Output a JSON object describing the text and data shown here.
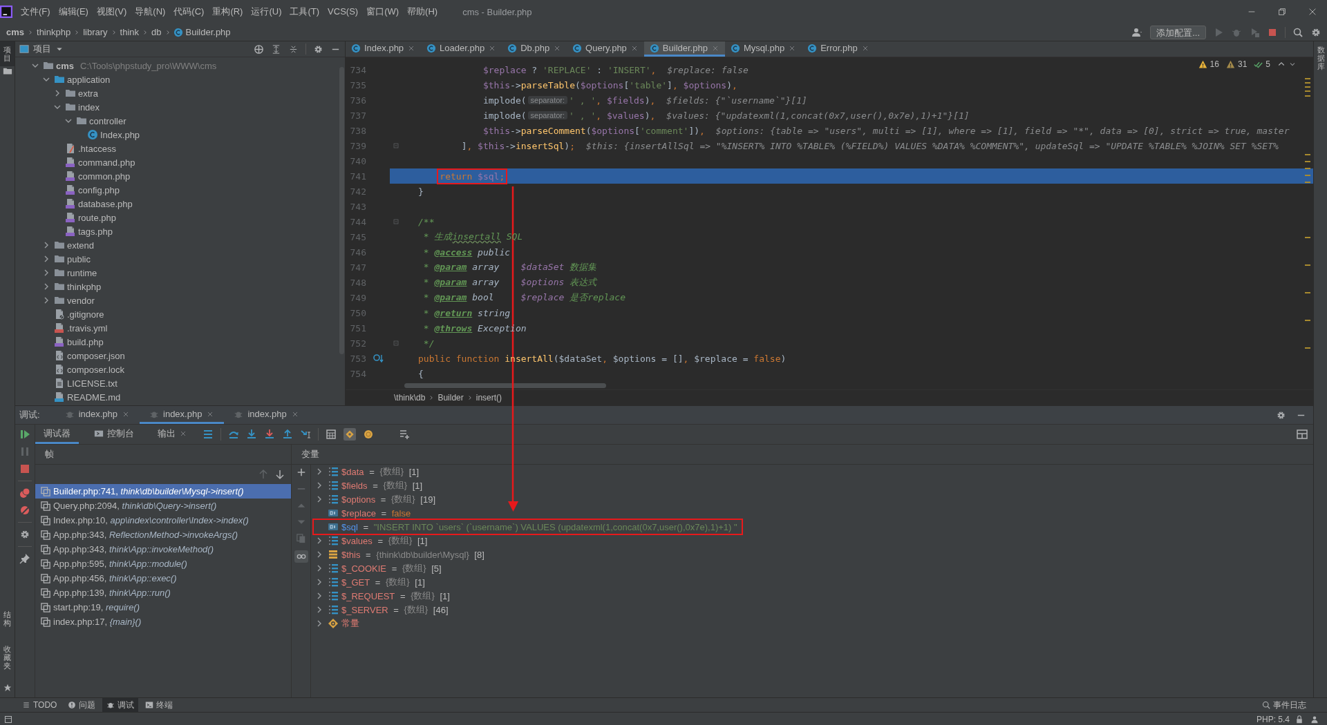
{
  "window": {
    "title": "cms - Builder.php",
    "menu": [
      "文件(F)",
      "编辑(E)",
      "视图(V)",
      "导航(N)",
      "代码(C)",
      "重构(R)",
      "运行(U)",
      "工具(T)",
      "VCS(S)",
      "窗口(W)",
      "帮助(H)"
    ]
  },
  "nav_bar": {
    "breadcrumb": [
      {
        "label": "cms",
        "kind": "root"
      },
      {
        "label": "thinkphp",
        "kind": "folder"
      },
      {
        "label": "library",
        "kind": "folder"
      },
      {
        "label": "think",
        "kind": "folder"
      },
      {
        "label": "db",
        "kind": "folder"
      },
      {
        "label": "Builder.php",
        "kind": "class"
      }
    ],
    "config_button": "添加配置..."
  },
  "left_stripe": {
    "top": [
      {
        "label": "项目",
        "selected": true
      }
    ],
    "bottom": [
      "结构",
      "收藏夹"
    ]
  },
  "right_stripe": [
    "数据库"
  ],
  "project": {
    "title": "项目",
    "tree": [
      {
        "label": "cms",
        "path": "C:\\Tools\\phpstudy_pro\\WWW\\cms",
        "kind": "folder",
        "expanded": true,
        "children": [
          {
            "label": "application",
            "kind": "source_folder",
            "expanded": true,
            "children": [
              {
                "label": "extra",
                "kind": "folder",
                "expanded": false
              },
              {
                "label": "index",
                "kind": "folder",
                "expanded": true,
                "children": [
                  {
                    "label": "controller",
                    "kind": "folder",
                    "expanded": true,
                    "children": [
                      {
                        "label": "Index.php",
                        "kind": "class"
                      }
                    ]
                  }
                ]
              },
              {
                "label": ".htaccess",
                "kind": "htaccess"
              },
              {
                "label": "command.php",
                "kind": "php"
              },
              {
                "label": "common.php",
                "kind": "php"
              },
              {
                "label": "config.php",
                "kind": "php"
              },
              {
                "label": "database.php",
                "kind": "php"
              },
              {
                "label": "route.php",
                "kind": "php"
              },
              {
                "label": "tags.php",
                "kind": "php"
              }
            ]
          },
          {
            "label": "extend",
            "kind": "folder",
            "expanded": false
          },
          {
            "label": "public",
            "kind": "folder",
            "expanded": false
          },
          {
            "label": "runtime",
            "kind": "folder",
            "expanded": false
          },
          {
            "label": "thinkphp",
            "kind": "folder",
            "expanded": false
          },
          {
            "label": "vendor",
            "kind": "folder",
            "expanded": false
          },
          {
            "label": ".gitignore",
            "kind": "ignore"
          },
          {
            "label": ".travis.yml",
            "kind": "yml"
          },
          {
            "label": "build.php",
            "kind": "php"
          },
          {
            "label": "composer.json",
            "kind": "json"
          },
          {
            "label": "composer.lock",
            "kind": "json"
          },
          {
            "label": "LICENSE.txt",
            "kind": "txt"
          },
          {
            "label": "README.md",
            "kind": "md"
          }
        ]
      }
    ]
  },
  "editor": {
    "tabs": [
      {
        "label": "Index.php",
        "selected": false
      },
      {
        "label": "Loader.php",
        "selected": false
      },
      {
        "label": "Db.php",
        "selected": false
      },
      {
        "label": "Query.php",
        "selected": false
      },
      {
        "label": "Builder.php",
        "selected": true
      },
      {
        "label": "Mysql.php",
        "selected": false
      },
      {
        "label": "Error.php",
        "selected": false
      }
    ],
    "inspections": [
      {
        "kind": "warning",
        "count": "16"
      },
      {
        "kind": "weak_warning",
        "count": "31"
      },
      {
        "kind": "ok",
        "count": "5"
      }
    ],
    "lines": [
      {
        "number": "734",
        "current": false,
        "segments": [
          {
            "kind": "code",
            "tokens": [
              {
                "text": "            $replace",
                "kind": "var"
              },
              {
                "text": " ? ",
                "kind": "plain"
              },
              {
                "text": "'REPLACE'",
                "kind": "str"
              },
              {
                "text": " : ",
                "kind": "plain"
              },
              {
                "text": "'INSERT'",
                "kind": "str"
              },
              {
                "text": ",",
                "kind": "kw"
              }
            ]
          },
          {
            "kind": "value",
            "text": "$replace: false"
          }
        ]
      },
      {
        "number": "735",
        "current": false,
        "segments": [
          {
            "kind": "code",
            "tokens": [
              {
                "text": "            $this",
                "kind": "var"
              },
              {
                "text": "->",
                "kind": "plain"
              },
              {
                "text": "parseTable",
                "kind": "fn"
              },
              {
                "text": "(",
                "kind": "plain"
              },
              {
                "text": "$options",
                "kind": "var"
              },
              {
                "text": "[",
                "kind": "plain"
              },
              {
                "text": "'table'",
                "kind": "str"
              },
              {
                "text": "]",
                "kind": "plain"
              },
              {
                "text": ", ",
                "kind": "kw"
              },
              {
                "text": "$options",
                "kind": "var"
              },
              {
                "text": ")",
                "kind": "plain"
              },
              {
                "text": ",",
                "kind": "kw"
              }
            ]
          }
        ]
      },
      {
        "number": "736",
        "current": false,
        "segments": [
          {
            "kind": "code",
            "tokens": [
              {
                "text": "            implode(",
                "kind": "plain"
              }
            ]
          },
          {
            "kind": "hint",
            "text": "separator:"
          },
          {
            "kind": "code",
            "tokens": [
              {
                "text": "' , '",
                "kind": "str"
              },
              {
                "text": ", ",
                "kind": "kw"
              },
              {
                "text": "$fields",
                "kind": "var"
              },
              {
                "text": ")",
                "kind": "plain"
              },
              {
                "text": ",",
                "kind": "kw"
              }
            ]
          },
          {
            "kind": "value",
            "text": "$fields: {\"`username`\"}[1]"
          }
        ]
      },
      {
        "number": "737",
        "current": false,
        "segments": [
          {
            "kind": "code",
            "tokens": [
              {
                "text": "            implode(",
                "kind": "plain"
              }
            ]
          },
          {
            "kind": "hint",
            "text": "separator:"
          },
          {
            "kind": "code",
            "tokens": [
              {
                "text": "' , '",
                "kind": "str"
              },
              {
                "text": ", ",
                "kind": "kw"
              },
              {
                "text": "$values",
                "kind": "var"
              },
              {
                "text": ")",
                "kind": "plain"
              },
              {
                "text": ",",
                "kind": "kw"
              }
            ]
          },
          {
            "kind": "value",
            "text": "$values: {\"updatexml(1,concat(0x7,user(),0x7e),1)+1\"}[1]"
          }
        ]
      },
      {
        "number": "738",
        "current": false,
        "segments": [
          {
            "kind": "code",
            "tokens": [
              {
                "text": "            $this",
                "kind": "var"
              },
              {
                "text": "->",
                "kind": "plain"
              },
              {
                "text": "parseComment",
                "kind": "fn"
              },
              {
                "text": "(",
                "kind": "plain"
              },
              {
                "text": "$options",
                "kind": "var"
              },
              {
                "text": "[",
                "kind": "plain"
              },
              {
                "text": "'comment'",
                "kind": "str"
              },
              {
                "text": "])",
                "kind": "plain"
              },
              {
                "text": ",",
                "kind": "kw"
              }
            ]
          },
          {
            "kind": "value",
            "text": "$options: {table => \"users\", multi => [1], where => [1], field => \"*\", data => [0], strict => true, master"
          }
        ]
      },
      {
        "number": "739",
        "current": false,
        "gutter": {
          "kind": "fold"
        },
        "segments": [
          {
            "kind": "code",
            "tokens": [
              {
                "text": "        ]",
                "kind": "plain"
              },
              {
                "text": ", ",
                "kind": "kw"
              },
              {
                "text": "$this",
                "kind": "var"
              },
              {
                "text": "->",
                "kind": "plain"
              },
              {
                "text": "insertSql",
                "kind": "fn"
              },
              {
                "text": ")",
                "kind": "plain"
              },
              {
                "text": ";",
                "kind": "kw"
              }
            ]
          },
          {
            "kind": "value",
            "text": "$this: {insertAllSql => \"%INSERT% INTO %TABLE% (%FIELD%) VALUES %DATA% %COMMENT%\", updateSql => \"UPDATE %TABLE% %JOIN% SET %SET%"
          }
        ]
      },
      {
        "number": "740",
        "current": false
      },
      {
        "number": "741",
        "current": true,
        "segments": [
          {
            "kind": "code",
            "annotated": true,
            "tokens": [
              {
                "text": "    return",
                "kind": "kw"
              },
              {
                "text": " $sql",
                "kind": "var"
              },
              {
                "text": ";",
                "kind": "kw"
              }
            ]
          }
        ]
      },
      {
        "number": "742",
        "current": false,
        "segments": [
          {
            "kind": "code",
            "tokens": [
              {
                "text": "}",
                "kind": "plain"
              }
            ]
          }
        ]
      },
      {
        "number": "743",
        "current": false
      },
      {
        "number": "744",
        "current": false,
        "gutter": {
          "kind": "fold"
        },
        "segments": [
          {
            "kind": "code",
            "tokens": [
              {
                "text": "/**",
                "kind": "doc"
              }
            ]
          }
        ]
      },
      {
        "number": "745",
        "current": false,
        "segments": [
          {
            "kind": "code",
            "tokens": [
              {
                "text": " * 生成",
                "kind": "doc"
              },
              {
                "text": "insertall",
                "kind": "typo"
              },
              {
                "text": " SQL",
                "kind": "doc"
              }
            ]
          }
        ]
      },
      {
        "number": "746",
        "current": false,
        "segments": [
          {
            "kind": "code",
            "tokens": [
              {
                "text": " * ",
                "kind": "doc"
              },
              {
                "text": "@access",
                "kind": "doctag"
              },
              {
                "text": " public",
                "kind": "doctype"
              }
            ]
          }
        ]
      },
      {
        "number": "747",
        "current": false,
        "segments": [
          {
            "kind": "code",
            "tokens": [
              {
                "text": " * ",
                "kind": "doc"
              },
              {
                "text": "@param",
                "kind": "doctag"
              },
              {
                "text": " array    ",
                "kind": "doctype"
              },
              {
                "text": "$dataSet",
                "kind": "docvar"
              },
              {
                "text": " 数据集",
                "kind": "doc"
              }
            ]
          }
        ]
      },
      {
        "number": "748",
        "current": false,
        "segments": [
          {
            "kind": "code",
            "tokens": [
              {
                "text": " * ",
                "kind": "doc"
              },
              {
                "text": "@param",
                "kind": "doctag"
              },
              {
                "text": " array    ",
                "kind": "doctype"
              },
              {
                "text": "$options",
                "kind": "docvar"
              },
              {
                "text": " 表达式",
                "kind": "doc"
              }
            ]
          }
        ]
      },
      {
        "number": "749",
        "current": false,
        "segments": [
          {
            "kind": "code",
            "tokens": [
              {
                "text": " * ",
                "kind": "doc"
              },
              {
                "text": "@param",
                "kind": "doctag"
              },
              {
                "text": " bool     ",
                "kind": "doctype"
              },
              {
                "text": "$replace",
                "kind": "docvar"
              },
              {
                "text": " 是否replace",
                "kind": "doc"
              }
            ]
          }
        ]
      },
      {
        "number": "750",
        "current": false,
        "segments": [
          {
            "kind": "code",
            "tokens": [
              {
                "text": " * ",
                "kind": "doc"
              },
              {
                "text": "@return",
                "kind": "doctag"
              },
              {
                "text": " string",
                "kind": "doctype"
              }
            ]
          }
        ]
      },
      {
        "number": "751",
        "current": false,
        "segments": [
          {
            "kind": "code",
            "tokens": [
              {
                "text": " * ",
                "kind": "doc"
              },
              {
                "text": "@throws",
                "kind": "doctag"
              },
              {
                "text": " Exception",
                "kind": "doctype"
              }
            ]
          }
        ]
      },
      {
        "number": "752",
        "current": false,
        "gutter": {
          "kind": "fold"
        },
        "segments": [
          {
            "kind": "code",
            "tokens": [
              {
                "text": " */",
                "kind": "doc"
              }
            ]
          }
        ]
      },
      {
        "number": "753",
        "current": false,
        "gutter": {
          "kind": "implements"
        },
        "segments": [
          {
            "kind": "code",
            "tokens": [
              {
                "text": "public function ",
                "kind": "kw"
              },
              {
                "text": "insertAll",
                "kind": "fn"
              },
              {
                "text": "(",
                "kind": "plain"
              },
              {
                "text": "$dataSet",
                "kind": "plain"
              },
              {
                "text": ", ",
                "kind": "kw"
              },
              {
                "text": "$options",
                "kind": "plain"
              },
              {
                "text": " = []",
                "kind": "plain"
              },
              {
                "text": ", ",
                "kind": "kw"
              },
              {
                "text": "$replace",
                "kind": "plain"
              },
              {
                "text": " = ",
                "kind": "plain"
              },
              {
                "text": "false",
                "kind": "kw"
              },
              {
                "text": ")",
                "kind": "plain"
              }
            ]
          }
        ]
      },
      {
        "number": "754",
        "current": false,
        "segments": [
          {
            "kind": "code",
            "tokens": [
              {
                "text": "{",
                "kind": "plain"
              }
            ]
          }
        ]
      }
    ],
    "breadcrumb": [
      "\\think\\db",
      "Builder",
      "insert()"
    ]
  },
  "debug": {
    "label": "调试:",
    "sessions": [
      {
        "label": "index.php",
        "selected": false
      },
      {
        "label": "index.php",
        "selected": true
      },
      {
        "label": "index.php",
        "selected": false
      }
    ],
    "tabs": [
      {
        "label": "调试器",
        "kind": "debugger",
        "selected": true
      },
      {
        "label": "控制台",
        "kind": "console",
        "selected": false
      },
      {
        "label": "输出",
        "kind": "output",
        "selected": false
      }
    ],
    "frames_title": "帧",
    "frames": [
      {
        "location": "Builder.php:741,",
        "method": "think\\db\\builder\\Mysql->insert()",
        "selected": true
      },
      {
        "location": "Query.php:2094,",
        "method": "think\\db\\Query->insert()",
        "selected": false
      },
      {
        "location": "Index.php:10,",
        "method": "app\\index\\controller\\Index->index()",
        "selected": false
      },
      {
        "location": "App.php:343,",
        "method": "ReflectionMethod->invokeArgs()",
        "selected": false
      },
      {
        "location": "App.php:343,",
        "method": "think\\App::invokeMethod()",
        "selected": false
      },
      {
        "location": "App.php:595,",
        "method": "think\\App::module()",
        "selected": false
      },
      {
        "location": "App.php:456,",
        "method": "think\\App::exec()",
        "selected": false
      },
      {
        "location": "App.php:139,",
        "method": "think\\App::run()",
        "selected": false
      },
      {
        "location": "start.php:19,",
        "method": "require()",
        "selected": false
      },
      {
        "location": "index.php:17,",
        "method": "{main}()",
        "selected": false
      }
    ],
    "variables_title": "变量",
    "variables": [
      {
        "name": "$data",
        "eq": "=",
        "type": "{数组}",
        "count": "[1]",
        "kind": "array",
        "expanded": false
      },
      {
        "name": "$fields",
        "eq": "=",
        "type": "{数组}",
        "count": "[1]",
        "kind": "array",
        "expanded": false
      },
      {
        "name": "$options",
        "eq": "=",
        "type": "{数组}",
        "count": "[19]",
        "kind": "array",
        "expanded": false
      },
      {
        "name": "$replace",
        "eq": "=",
        "value": {
          "text": "false",
          "kind": "bool"
        },
        "kind": "scalar"
      },
      {
        "name": "$sql",
        "eq": "=",
        "value": {
          "text": "\"INSERT INTO `users` (`username`) VALUES (updatexml(1,concat(0x7,user(),0x7e),1)+1) \"",
          "kind": "string"
        },
        "kind": "scalar",
        "changed": true,
        "annotated": true
      },
      {
        "name": "$values",
        "eq": "=",
        "type": "{数组}",
        "count": "[1]",
        "kind": "array",
        "expanded": false
      },
      {
        "name": "$this",
        "eq": "=",
        "type": "{think\\db\\builder\\Mysql}",
        "count": "[8]",
        "kind": "object",
        "expanded": false
      },
      {
        "name": "$_COOKIE",
        "eq": "=",
        "type": "{数组}",
        "count": "[5]",
        "kind": "array",
        "expanded": false
      },
      {
        "name": "$_GET",
        "eq": "=",
        "type": "{数组}",
        "count": "[1]",
        "kind": "array",
        "expanded": false
      },
      {
        "name": "$_REQUEST",
        "eq": "=",
        "type": "{数组}",
        "count": "[1]",
        "kind": "array",
        "expanded": false
      },
      {
        "name": "$_SERVER",
        "eq": "=",
        "type": "{数组}",
        "count": "[46]",
        "kind": "array",
        "expanded": false
      },
      {
        "name": "常量",
        "kind": "const",
        "expanded": false
      }
    ]
  },
  "tool_strip": {
    "items": [
      {
        "label": "TODO",
        "kind": "todo",
        "selected": false
      },
      {
        "label": "问题",
        "kind": "problems",
        "selected": false
      },
      {
        "label": "调试",
        "kind": "debug",
        "selected": true
      },
      {
        "label": "终端",
        "kind": "terminal",
        "selected": false
      }
    ],
    "event_log": "事件日志"
  },
  "status_bar": {
    "php": "PHP: 5.4"
  }
}
